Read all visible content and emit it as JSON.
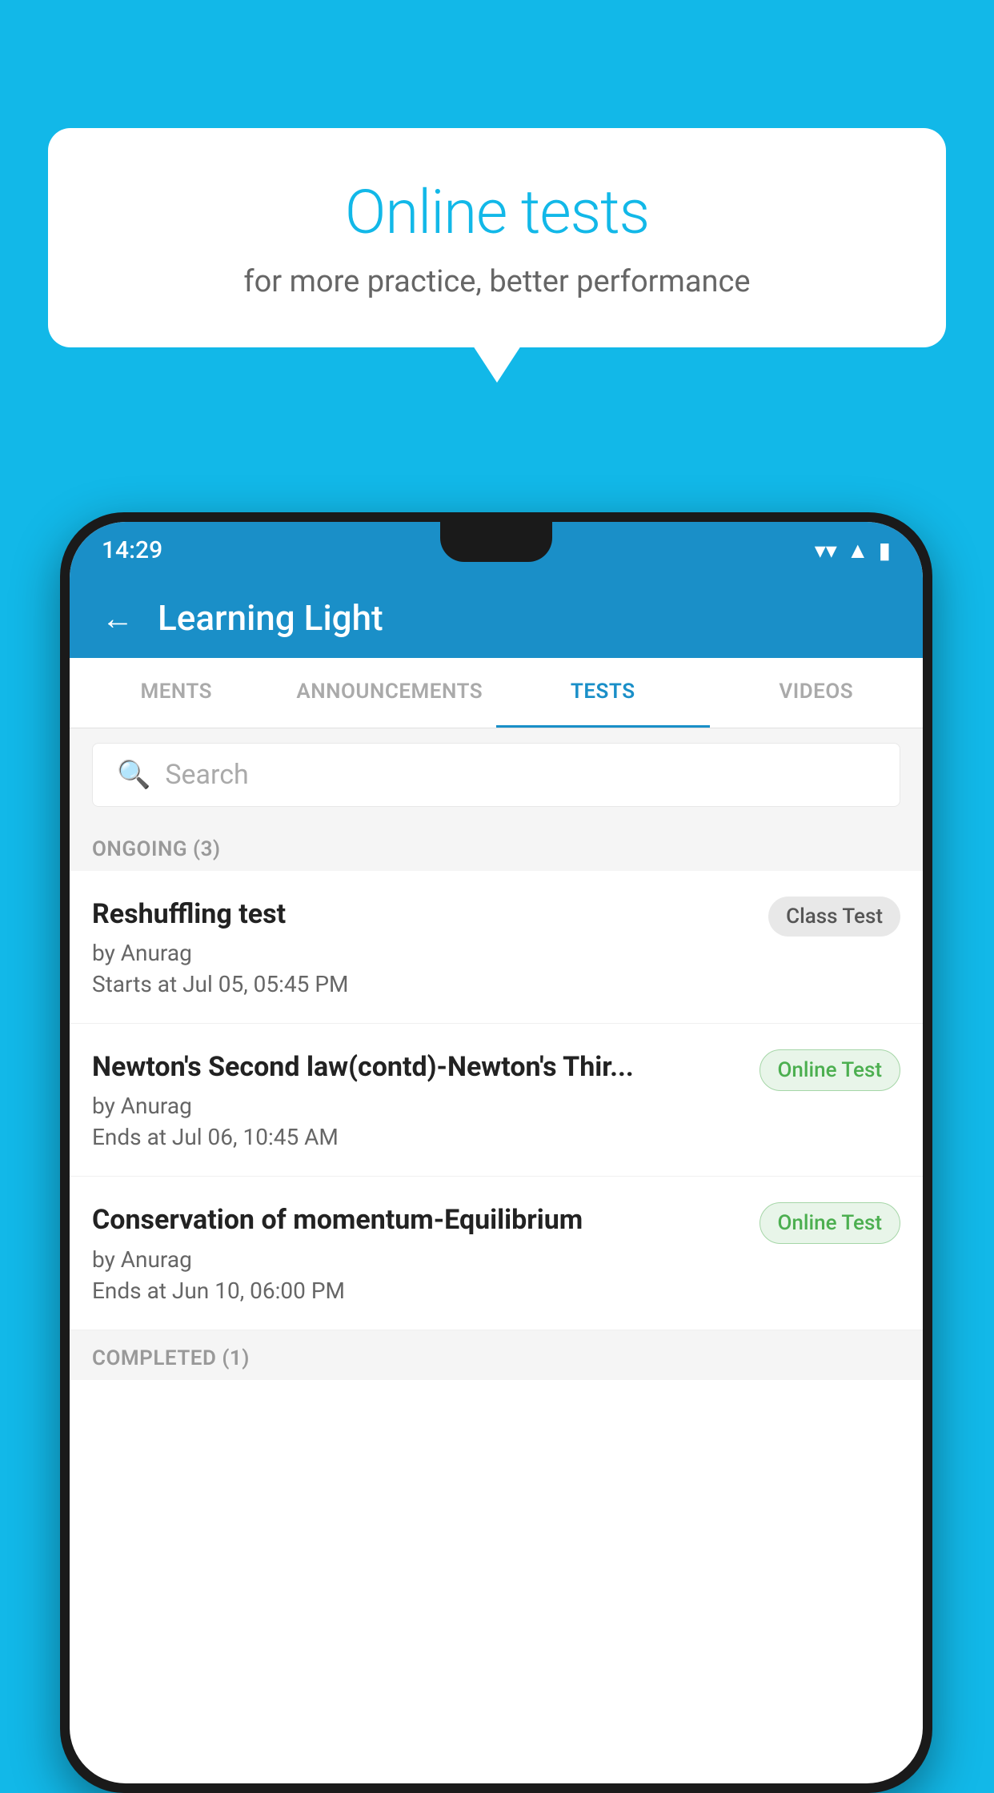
{
  "background_color": "#12b8e8",
  "bubble": {
    "title": "Online tests",
    "subtitle": "for more practice, better performance"
  },
  "status_bar": {
    "time": "14:29",
    "wifi": "▼",
    "signal": "▲",
    "battery": "▮"
  },
  "header": {
    "title": "Learning Light",
    "back_label": "←"
  },
  "tabs": [
    {
      "label": "MENTS",
      "active": false
    },
    {
      "label": "ANNOUNCEMENTS",
      "active": false
    },
    {
      "label": "TESTS",
      "active": true
    },
    {
      "label": "VIDEOS",
      "active": false
    }
  ],
  "search": {
    "placeholder": "Search"
  },
  "ongoing_section": {
    "label": "ONGOING (3)"
  },
  "tests": [
    {
      "title": "Reshuffling test",
      "author": "by Anurag",
      "time_label": "Starts at",
      "time": "Jul 05, 05:45 PM",
      "badge": "Class Test",
      "badge_type": "class"
    },
    {
      "title": "Newton's Second law(contd)-Newton's Thir...",
      "author": "by Anurag",
      "time_label": "Ends at",
      "time": "Jul 06, 10:45 AM",
      "badge": "Online Test",
      "badge_type": "online"
    },
    {
      "title": "Conservation of momentum-Equilibrium",
      "author": "by Anurag",
      "time_label": "Ends at",
      "time": "Jun 10, 06:00 PM",
      "badge": "Online Test",
      "badge_type": "online"
    }
  ],
  "completed_section": {
    "label": "COMPLETED (1)"
  }
}
